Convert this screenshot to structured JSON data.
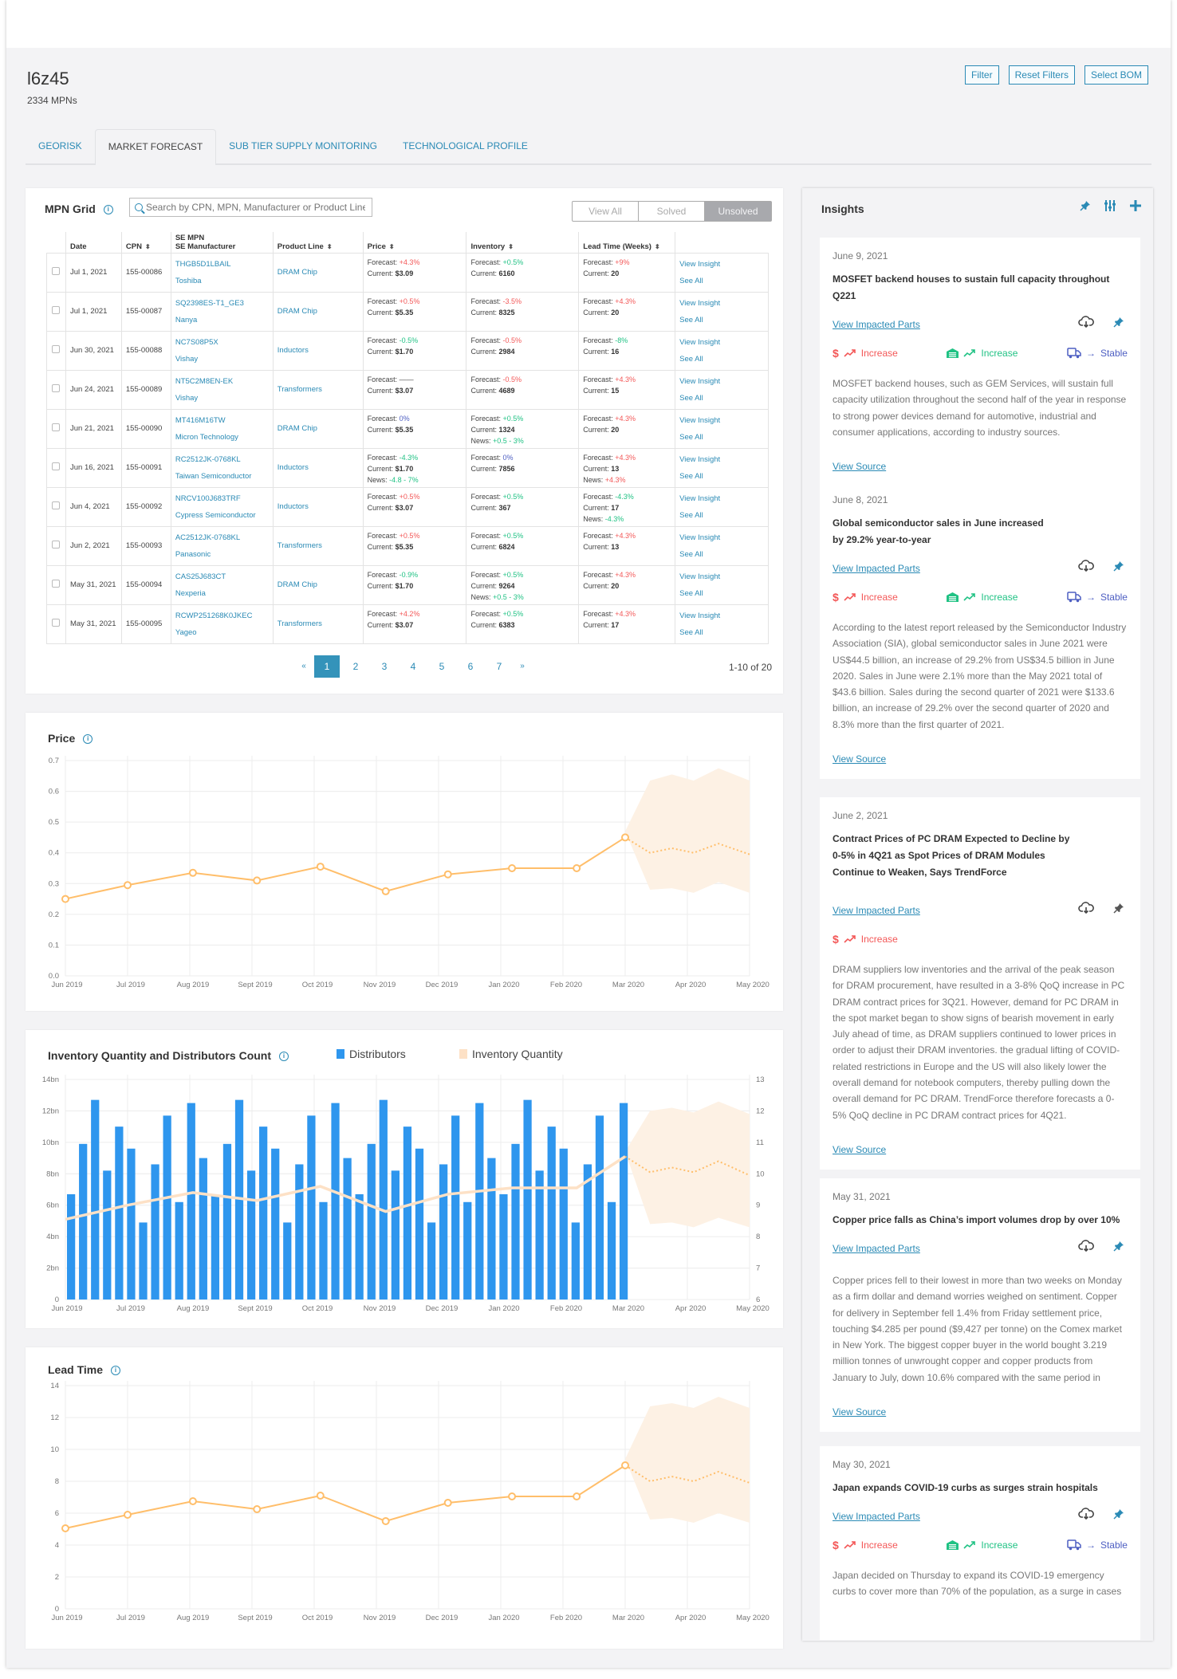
{
  "header": {
    "title": "l6z45",
    "subtitle": "2334 MPNs",
    "buttons": {
      "filter": "Filter",
      "reset": "Reset Filters",
      "select_bom": "Select BOM"
    }
  },
  "tabs": [
    {
      "label": "GEORISK",
      "active": false
    },
    {
      "label": "MARKET FORECAST",
      "active": true
    },
    {
      "label": "SUB TIER SUPPLY MONITORING",
      "active": false
    },
    {
      "label": "TECHNOLOGICAL PROFILE",
      "active": false
    }
  ],
  "grid": {
    "title": "MPN Grid",
    "search_placeholder": "Search by CPN, MPN, Manufacturer or Product Line",
    "segments": [
      "View All",
      "Solved",
      "Unsolved"
    ],
    "active_segment": "Unsolved",
    "columns": {
      "date": "Date",
      "cpn": "CPN",
      "mpn1": "SE MPN",
      "mpn2": "SE Manufacturer",
      "product_line": "Product Line",
      "price": "Price",
      "inventory": "Inventory",
      "lead_time": "Lead Time (Weeks)"
    },
    "labels": {
      "forecast": "Forecast: ",
      "current": "Current: ",
      "news": "News: ",
      "view_insight": "View Insight",
      "see_all": "See All"
    },
    "rows": [
      {
        "date": "Jul 1, 2021",
        "cpn": "155-00086",
        "mpn": "THGB5D1LBAIL",
        "mfr": "Toshiba",
        "pl": "DRAM Chip",
        "price": {
          "f": "+4.3%",
          "fc": "red",
          "c": "$3.09"
        },
        "inv": {
          "f": "+0.5%",
          "fc": "green",
          "c": "6160"
        },
        "lt": {
          "f": "+9%",
          "fc": "red",
          "c": "20"
        }
      },
      {
        "date": "Jul 1, 2021",
        "cpn": "155-00087",
        "mpn": "SQ2398ES-T1_GE3",
        "mfr": "Nanya",
        "pl": "DRAM Chip",
        "price": {
          "f": "+0.5%",
          "fc": "red",
          "c": "$5.35"
        },
        "inv": {
          "f": "-3.5%",
          "fc": "red",
          "c": "8325"
        },
        "lt": {
          "f": "+4.3%",
          "fc": "red",
          "c": "20"
        }
      },
      {
        "date": "Jun 30, 2021",
        "cpn": "155-00088",
        "mpn": "NC7S08P5X",
        "mfr": "Vishay",
        "pl": "Inductors",
        "price": {
          "f": "-0.5%",
          "fc": "green",
          "c": "$1.70"
        },
        "inv": {
          "f": "-0.5%",
          "fc": "red",
          "c": "2984"
        },
        "lt": {
          "f": "-8%",
          "fc": "green",
          "c": "16"
        }
      },
      {
        "date": "Jun 24, 2021",
        "cpn": "155-00089",
        "mpn": "NT5C2M8EN-EK",
        "mfr": "Vishay",
        "pl": "Transformers",
        "price": {
          "f": "——",
          "fc": "gray",
          "c": "$3.07"
        },
        "inv": {
          "f": "-0.5%",
          "fc": "red",
          "c": "4689"
        },
        "lt": {
          "f": "+4.3%",
          "fc": "red",
          "c": "15"
        }
      },
      {
        "date": "Jun 21, 2021",
        "cpn": "155-00090",
        "mpn": "MT416M16TW",
        "mfr": "Micron Technology",
        "pl": "DRAM Chip",
        "price": {
          "f": "0%",
          "fc": "blue",
          "c": "$5.35"
        },
        "inv": {
          "f": "+0.5%",
          "fc": "green",
          "c": "1324",
          "n": "+0.5 - 3%",
          "nc": "green"
        },
        "lt": {
          "f": "+4.3%",
          "fc": "red",
          "c": "20"
        }
      },
      {
        "date": "Jun 16, 2021",
        "cpn": "155-00091",
        "mpn": "RC2512JK-0768KL",
        "mfr": "Taiwan Semiconductor",
        "pl": "Inductors",
        "price": {
          "f": "-4.3%",
          "fc": "green",
          "c": "$1.70",
          "n": "-4.8 - 7%",
          "nc": "green"
        },
        "inv": {
          "f": "0%",
          "fc": "blue",
          "c": "7856"
        },
        "lt": {
          "f": "+4.3%",
          "fc": "red",
          "c": "13",
          "n": "+4.3%",
          "nc": "red"
        }
      },
      {
        "date": "Jun 4, 2021",
        "cpn": "155-00092",
        "mpn": "NRCV100J683TRF",
        "mfr": "Cypress Semiconductor",
        "pl": "Inductors",
        "price": {
          "f": "+0.5%",
          "fc": "red",
          "c": "$3.07"
        },
        "inv": {
          "f": "+0.5%",
          "fc": "green",
          "c": "367"
        },
        "lt": {
          "f": "-4.3%",
          "fc": "green",
          "c": "17",
          "n": "-4.3%",
          "nc": "green"
        }
      },
      {
        "date": "Jun 2, 2021",
        "cpn": "155-00093",
        "mpn": "AC2512JK-0768KL",
        "mfr": "Panasonic",
        "pl": "Transformers",
        "price": {
          "f": "+0.5%",
          "fc": "red",
          "c": "$5.35"
        },
        "inv": {
          "f": "+0.5%",
          "fc": "green",
          "c": "6824"
        },
        "lt": {
          "f": "+4.3%",
          "fc": "red",
          "c": "13"
        }
      },
      {
        "date": "May 31, 2021",
        "cpn": "155-00094",
        "mpn": "CAS25J683CT",
        "mfr": "Nexperia",
        "pl": "DRAM Chip",
        "price": {
          "f": "-0.9%",
          "fc": "green",
          "c": "$1.70"
        },
        "inv": {
          "f": "+0.5%",
          "fc": "green",
          "c": "9264",
          "n": "+0.5 - 3%",
          "nc": "green"
        },
        "lt": {
          "f": "+4.3%",
          "fc": "red",
          "c": "20"
        }
      },
      {
        "date": "May 31, 2021",
        "cpn": "155-00095",
        "mpn": "RCWP251268K0JKEC",
        "mfr": "Yageo",
        "pl": "Transformers",
        "price": {
          "f": "+4.2%",
          "fc": "red",
          "c": "$3.07"
        },
        "inv": {
          "f": "+0.5%",
          "fc": "green",
          "c": "6383"
        },
        "lt": {
          "f": "+4.3%",
          "fc": "red",
          "c": "17"
        }
      }
    ],
    "pagination": {
      "prev": "«",
      "pages": [
        "1",
        "2",
        "3",
        "4",
        "5",
        "6",
        "7"
      ],
      "current": "1",
      "next": "»",
      "count": "1-10 of 20"
    }
  },
  "colors": {
    "accent": "#2a8ab5",
    "line": "#ffbe6a",
    "band": "#fdf1e4",
    "bar": "#2e96ee",
    "inv_line": "#fde1c6",
    "red": "#f35757",
    "green": "#20c284",
    "blue": "#4d5ec2"
  },
  "chart_data": [
    {
      "type": "line",
      "title": "Price",
      "x": [
        "Jun 2019",
        "Jul 2019",
        "Aug 2019",
        "Sept 2019",
        "Oct 2019",
        "Nov 2019",
        "Dec 2019",
        "Jan 2020",
        "Feb 2020",
        "Mar 2020",
        "Apr 2020",
        "May 2020"
      ],
      "ylim": [
        0,
        0.7
      ],
      "yticks": [
        "0.0",
        "0.1",
        "0.2",
        "0.3",
        "0.4",
        "0.5",
        "0.6",
        "0.7"
      ],
      "actual": [
        [
          0,
          0.25
        ],
        [
          1,
          0.295
        ],
        [
          2.05,
          0.335
        ],
        [
          3.08,
          0.31
        ],
        [
          4.1,
          0.355
        ],
        [
          5.15,
          0.275
        ],
        [
          6.15,
          0.33
        ],
        [
          7.18,
          0.35
        ],
        [
          8.22,
          0.35
        ],
        [
          9,
          0.45
        ]
      ],
      "forecast": [
        [
          9,
          0.45
        ],
        [
          9.4,
          0.4
        ],
        [
          9.75,
          0.415
        ],
        [
          10.1,
          0.4
        ],
        [
          10.5,
          0.43
        ],
        [
          11,
          0.395
        ]
      ],
      "band_upper": [
        [
          9,
          0.47
        ],
        [
          9.4,
          0.635
        ],
        [
          9.75,
          0.655
        ],
        [
          10.1,
          0.635
        ],
        [
          10.5,
          0.675
        ],
        [
          11,
          0.635
        ]
      ],
      "band_lower": [
        [
          9,
          0.47
        ],
        [
          9.4,
          0.28
        ],
        [
          9.75,
          0.285
        ],
        [
          10.1,
          0.27
        ],
        [
          10.5,
          0.305
        ],
        [
          11,
          0.27
        ]
      ],
      "grid": true
    },
    {
      "type": "bar",
      "title": "Inventory Quantity and Distributors Count",
      "legend": [
        "Distributors",
        "Inventory Quantity"
      ],
      "x": [
        "Jun 2019",
        "Jul 2019",
        "Aug 2019",
        "Sept 2019",
        "Oct 2019",
        "Nov 2019",
        "Dec 2019",
        "Jan 2020",
        "Feb 2020",
        "Mar 2020",
        "Apr 2020",
        "May 2020"
      ],
      "ylim_left": [
        0,
        14
      ],
      "yticks_left": [
        "0",
        "2bn",
        "4bn",
        "6bn",
        "8bn",
        "10bn",
        "12bn",
        "14bn"
      ],
      "ylim_right": [
        6,
        13
      ],
      "yticks_right": [
        "6",
        "7",
        "8",
        "9",
        "10",
        "11",
        "12",
        "13"
      ],
      "distributors_bn": [
        6.7,
        9.9,
        12.7,
        8.2,
        11.0,
        9.6,
        4.9,
        8.6,
        11.7,
        6.2,
        12.5,
        9.0,
        6.6,
        9.9,
        12.7,
        8.2,
        11.0,
        9.6,
        4.9,
        8.6,
        11.7,
        6.2,
        12.5,
        9.0,
        6.7,
        9.9,
        12.7,
        8.2,
        11.0,
        9.6,
        4.9,
        8.6,
        11.7,
        6.2,
        12.5,
        9.0,
        6.7,
        9.9,
        12.7,
        8.2,
        11.0,
        9.6,
        4.9,
        8.6,
        11.7,
        6.2,
        12.5
      ],
      "inventory_actual": [
        [
          0,
          8.55
        ],
        [
          1,
          9.0
        ],
        [
          2.05,
          9.4
        ],
        [
          3.08,
          9.15
        ],
        [
          4.1,
          9.6
        ],
        [
          5.15,
          8.8
        ],
        [
          6.15,
          9.35
        ],
        [
          7.18,
          9.55
        ],
        [
          8.22,
          9.55
        ],
        [
          9,
          10.55
        ]
      ],
      "inventory_forecast": [
        [
          9,
          10.55
        ],
        [
          9.4,
          10.05
        ],
        [
          9.75,
          10.2
        ],
        [
          10.1,
          10.05
        ],
        [
          10.5,
          10.4
        ],
        [
          11,
          9.95
        ]
      ],
      "band_upper": [
        [
          9,
          10.7
        ],
        [
          9.4,
          12.0
        ],
        [
          9.75,
          12.1
        ],
        [
          10.1,
          11.95
        ],
        [
          10.5,
          12.3
        ],
        [
          11,
          11.9
        ]
      ],
      "band_lower": [
        [
          9,
          10.7
        ],
        [
          9.4,
          8.4
        ],
        [
          9.75,
          8.45
        ],
        [
          10.1,
          8.3
        ],
        [
          10.5,
          8.6
        ],
        [
          11,
          8.3
        ]
      ],
      "grid": true
    },
    {
      "type": "line",
      "title": "Lead Time",
      "x": [
        "Jun 2019",
        "Jul 2019",
        "Aug 2019",
        "Sept 2019",
        "Oct 2019",
        "Nov 2019",
        "Dec 2019",
        "Jan 2020",
        "Feb 2020",
        "Mar 2020",
        "Apr 2020",
        "May 2020"
      ],
      "ylim": [
        0,
        14
      ],
      "yticks": [
        "0",
        "2",
        "4",
        "6",
        "8",
        "10",
        "12",
        "14"
      ],
      "actual": [
        [
          0,
          5.05
        ],
        [
          1,
          5.9
        ],
        [
          2.05,
          6.75
        ],
        [
          3.08,
          6.25
        ],
        [
          4.1,
          7.1
        ],
        [
          5.15,
          5.5
        ],
        [
          6.15,
          6.65
        ],
        [
          7.18,
          7.05
        ],
        [
          8.22,
          7.05
        ],
        [
          9,
          9.0
        ]
      ],
      "forecast": [
        [
          9,
          9.0
        ],
        [
          9.4,
          8.0
        ],
        [
          9.75,
          8.3
        ],
        [
          10.1,
          8.0
        ],
        [
          10.5,
          8.6
        ],
        [
          11,
          7.9
        ]
      ],
      "band_upper": [
        [
          9,
          9.4
        ],
        [
          9.4,
          12.7
        ],
        [
          9.75,
          12.9
        ],
        [
          10.1,
          12.6
        ],
        [
          10.5,
          13.3
        ],
        [
          11,
          12.6
        ]
      ],
      "band_lower": [
        [
          9,
          9.4
        ],
        [
          9.4,
          5.6
        ],
        [
          9.75,
          5.7
        ],
        [
          10.1,
          5.4
        ],
        [
          10.5,
          6.0
        ],
        [
          11,
          5.4
        ]
      ],
      "grid": true
    }
  ],
  "insights": {
    "title": "Insights",
    "labels": {
      "view_impacted_parts": "View Impacted Parts",
      "view_source": "View Source",
      "increase": "Increase",
      "stable": "Stable"
    },
    "cards": [
      {
        "date": "June 9, 2021",
        "headline": "MOSFET backend houses to sustain full capacity throughout Q221",
        "price": "Increase",
        "inventory": "Increase",
        "lead_time": "Stable",
        "body": "MOSFET backend houses, such as GEM Services, will sustain full capacity utilization throughout the second half of the year in response to strong power devices demand for automotive, industrial and consumer applications, according to industry sources."
      },
      {
        "date": "June 8, 2021",
        "headline": "Global semiconductor sales in June increased by 29.2% year-to-year",
        "price": "Increase",
        "inventory": "Increase",
        "lead_time": "Stable",
        "body": "According to the latest report released by the Semiconductor Industry Association (SIA), global semiconductor sales in June 2021 were US$44.5 billion, an increase of 29.2% from US$34.5 billion in June 2020. Sales in June were 2.1% more than the May 2021 total of $43.6 billion. Sales during the second quarter of 2021 were $133.6 billion, an increase of 29.2% over the second quarter of 2020 and 8.3% more than the first quarter of 2021."
      },
      {
        "date": "June 2, 2021",
        "headline": "Contract Prices of PC DRAM Expected to Decline by 0-5% in 4Q21 as Spot Prices of DRAM Modules Continue to Weaken, Says TrendForce",
        "price": "Increase",
        "body": "DRAM suppliers low inventories and the arrival of the peak season for DRAM procurement, have resulted in a 3-8% QoQ increase in PC DRAM contract prices for 3Q21. However, demand for PC DRAM in the spot market began to show signs of bearish movement in early July ahead of time, as DRAM suppliers continued to lower prices in order to adjust their DRAM inventories. the gradual lifting of COVID-related restrictions in Europe and the US will also likely lower the overall demand for notebook computers, thereby pulling down the overall demand for PC DRAM. TrendForce therefore forecasts a 0-5% QoQ decline in PC DRAM contract prices for 4Q21."
      },
      {
        "date": "May 31, 2021",
        "headline": "Copper price falls as China’s import volumes drop by over 10%",
        "body": "Copper prices fell to their lowest in more than two weeks on Monday as a firm dollar and demand worries weighed on sentiment. Copper for delivery in September fell 1.4% from Friday settlement price, touching $4.285 per pound ($9,427 per tonne) on the Comex market in New York. The biggest copper buyer in the world bought 3.219 million tonnes of unwrought copper and copper products from January to July, down 10.6% compared with the same period in"
      },
      {
        "date": "May 30, 2021",
        "headline": "Japan expands COVID-19 curbs as surges strain hospitals",
        "price": "Increase",
        "inventory": "Increase",
        "lead_time": "Stable",
        "body": "Japan decided on Thursday to expand its COVID-19 emergency curbs to cover more than 70% of the population, as a surge in cases"
      }
    ]
  }
}
